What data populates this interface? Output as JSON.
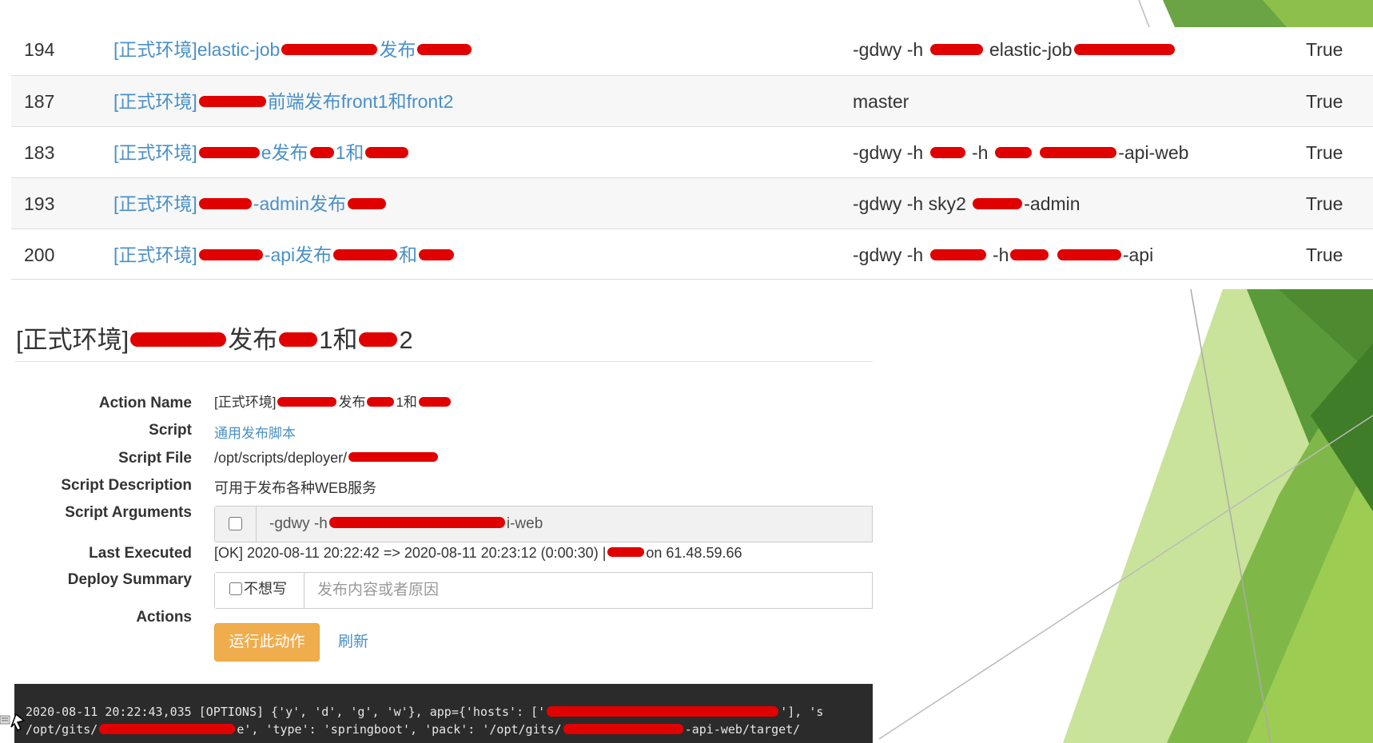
{
  "table": {
    "rows": [
      {
        "id": "194",
        "name_prefix": "[正式环境]elastic-job",
        "name_suffix": "发布",
        "args_prefix": "-gdwy -h",
        "args_suffix": "elastic-job",
        "flag": "True"
      },
      {
        "id": "187",
        "name_prefix": "[正式环境]",
        "name_suffix": "前端发布front1和front2",
        "args_prefix": "master",
        "args_suffix": "",
        "flag": "True"
      },
      {
        "id": "183",
        "name_prefix": "[正式环境]",
        "name_suffix": "e发布",
        "name_mid": "1和",
        "args_prefix": "-gdwy -h",
        "args_mid": "-h",
        "args_suffix": "-api-web",
        "flag": "True"
      },
      {
        "id": "193",
        "name_prefix": "[正式环境]",
        "name_suffix": "-admin发布",
        "args_prefix": "-gdwy -h sky2",
        "args_suffix": "-admin",
        "flag": "True"
      },
      {
        "id": "200",
        "name_prefix": "[正式环境]",
        "name_suffix": "-api发布",
        "name_mid": "和",
        "args_prefix": "-gdwy -h",
        "args_mid": "-h",
        "args_suffix": "-api",
        "flag": "True"
      }
    ]
  },
  "detail": {
    "title_prefix": "[正式环境]",
    "title_mid": "发布",
    "title_mid2": "1和",
    "title_suffix": "2",
    "labels": {
      "action_name": "Action Name",
      "script": "Script",
      "script_file": "Script File",
      "script_description": "Script Description",
      "script_arguments": "Script Arguments",
      "last_executed": "Last Executed",
      "deploy_summary": "Deploy Summary",
      "actions": "Actions"
    },
    "action_name_prefix": "[正式环境]",
    "action_name_mid": "发布",
    "action_name_mid2": "1和",
    "script": "通用发布脚本",
    "script_file": "/opt/scripts/deployer/",
    "script_description": "可用于发布各种WEB服务",
    "script_arguments_prefix": "-gdwy -h",
    "script_arguments_suffix": "i-web",
    "last_executed": "[OK] 2020-08-11 20:22:42 => 2020-08-11 20:23:12 (0:00:30) |",
    "last_executed_suffix": "on 61.48.59.66",
    "deploy_summary_checkbox_label": "不想写",
    "deploy_summary_placeholder": "发布内容或者原因",
    "run_button": "运行此动作",
    "refresh_link": "刷新"
  },
  "console": {
    "line1_prefix": "2020-08-11 20:22:43,035 [OPTIONS] {'y', 'd', 'g', 'w'}, app={'hosts': ['",
    "line1_suffix": "'], 's",
    "line2_prefix": "/opt/gits/",
    "line2_mid": "e', 'type': 'springboot', 'pack': '/opt/gits/",
    "line2_suffix": "-api-web/target/"
  },
  "colors": {
    "link": "#4a90c8",
    "redaction": "#e10000",
    "run_button": "#f0ad4e",
    "console_bg": "#2b2b2b",
    "deco_green_dark": "#5a9a3a",
    "deco_green_light": "#c9e39a"
  }
}
